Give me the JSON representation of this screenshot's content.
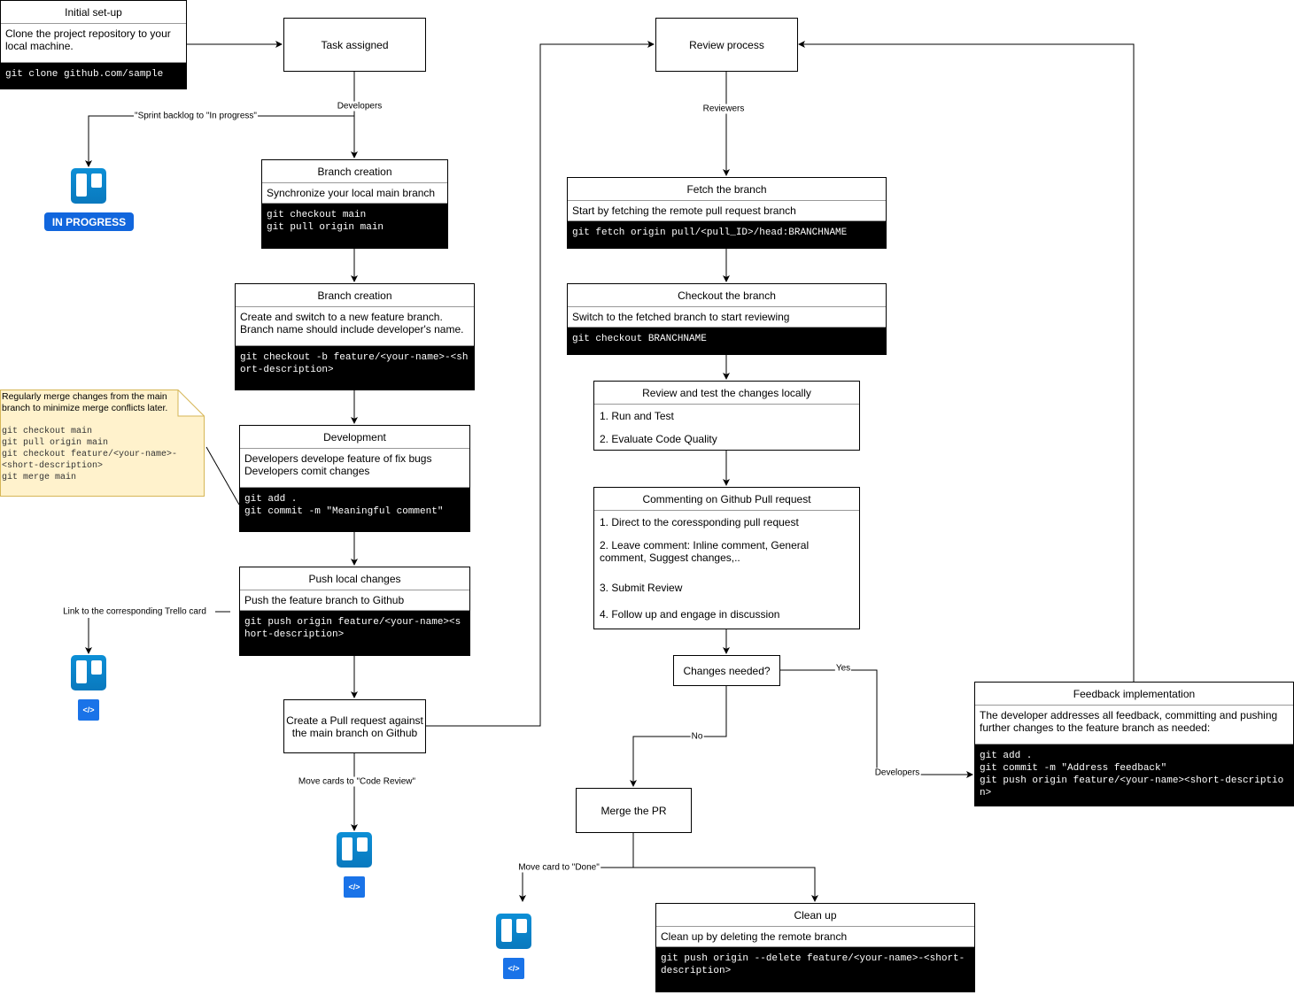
{
  "initial": {
    "title": "Initial set-up",
    "desc": "Clone the project repository to your local machine.",
    "code": "git clone github.com/sample"
  },
  "task": "Task assigned",
  "branch1": {
    "title": "Branch creation",
    "desc": "Synchronize your local main branch",
    "code": "git checkout main\ngit pull origin main"
  },
  "branch2": {
    "title": "Branch creation",
    "desc": "Create and switch to a new feature branch.\nBranch name should include developer's name.",
    "code": "git checkout -b feature/<your-name>-<short-description>"
  },
  "note": {
    "text": "Regularly merge changes from the main branch to minimize merge conflicts later.",
    "code": "git checkout main\ngit pull origin main\ngit checkout feature/<your-name>-<short-description>\ngit merge main"
  },
  "development": {
    "title": "Development",
    "desc": "Developers develope feature of fix bugs\nDevelopers comit changes",
    "code": "git add .\ngit commit -m \"Meaningful comment\""
  },
  "push": {
    "title": "Push local changes",
    "desc": "Push the feature branch to Github",
    "code": "git push origin feature/<your-name><short-description>"
  },
  "create_pr": "Create a Pull request against the main branch on Github",
  "review": "Review process",
  "fetch": {
    "title": "Fetch the branch",
    "desc": "Start by fetching the remote pull request branch",
    "code": "git fetch origin pull/<pull_ID>/head:BRANCHNAME"
  },
  "checkout": {
    "title": "Checkout the branch",
    "desc": "Switch to the fetched branch to start  reviewing",
    "code": "git checkout BRANCHNAME"
  },
  "review_test": {
    "title": "Review and test the changes locally",
    "items": [
      "1. Run and Test",
      "2. Evaluate Code Quality"
    ]
  },
  "commenting": {
    "title": "Commenting on Github Pull request",
    "items": [
      "1. Direct to the coressponding pull request",
      "2. Leave comment: Inline comment, General comment, Suggest changes,..",
      "3. Submit Review",
      "4. Follow up and engage in discussion"
    ]
  },
  "changes_needed": "Changes needed?",
  "merge": "Merge the PR",
  "feedback": {
    "title": "Feedback implementation",
    "desc": "The developer addresses all feedback, committing and pushing further changes to the feature branch as needed:",
    "code": "git add .\ngit commit -m \"Address feedback\"\ngit push origin feature/<your-name><short-description>"
  },
  "cleanup": {
    "title": "Clean up",
    "desc": "Clean up by deleting the remote branch",
    "code": "git push origin --delete feature/<your-name>-<short-description>"
  },
  "labels": {
    "developers": "Developers",
    "sprint": "\"Sprint backlog to \"In progress\"",
    "trello_link": "Link to the corresponding Trello card",
    "code_review": "Move cards to \"Code Review\"",
    "reviewers": "Reviewers",
    "yes": "Yes",
    "no": "No",
    "developers2": "Developers",
    "done": "Move card to \"Done\""
  },
  "badge": "IN PROGRESS",
  "icons": {
    "trello": "trello-icon",
    "code": "code-icon"
  },
  "colors": {
    "note_fill": "#fff2cc",
    "note_border": "#d6b656",
    "badge": "#1166dd",
    "trello": "#0c8fd6"
  }
}
